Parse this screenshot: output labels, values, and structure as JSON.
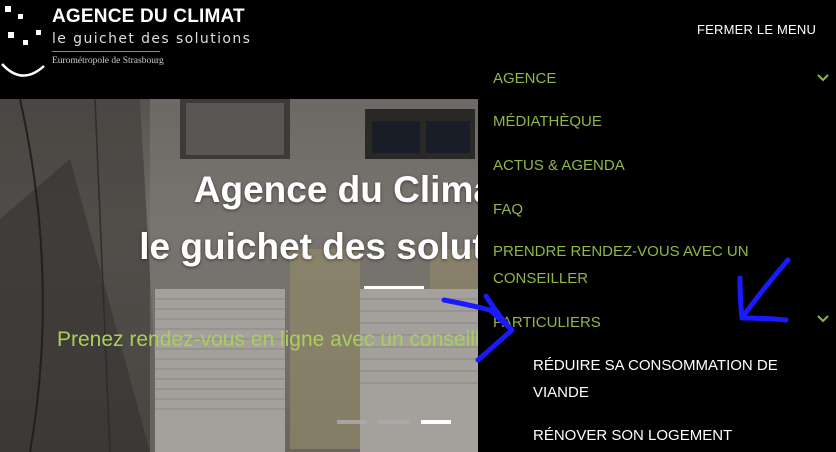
{
  "header": {
    "logo_title": "AGENCE DU CLIMAT",
    "logo_subtitle": "le guichet des solutions",
    "logo_tagline": "Eurométropole de Strasbourg",
    "close_menu": "FERMER LE MENU"
  },
  "hero": {
    "title_line1": "Agence du Climat",
    "title_line2": "le guichet des solutions",
    "subtitle": "Prenez rendez-vous en ligne avec un conseiller",
    "slides": 3,
    "active_slide": 3
  },
  "menu": {
    "items": [
      {
        "label": "AGENCE",
        "has_submenu": true
      },
      {
        "label": "MÉDIATHÈQUE"
      },
      {
        "label": "ACTUS & AGENDA"
      },
      {
        "label": "FAQ"
      },
      {
        "label": "PRENDRE RENDEZ-VOUS AVEC UN CONSEILLER"
      },
      {
        "label": "PARTICULIERS",
        "has_submenu": true
      }
    ],
    "submenu": [
      {
        "label": "RÉDUIRE SA CONSOMMATION DE VIANDE"
      },
      {
        "label": "RÉNOVER SON LOGEMENT"
      }
    ]
  },
  "colors": {
    "menu_text": "#8fb844",
    "hero_subtitle": "#a9cf5a",
    "annotation": "#1a1aff",
    "background": "#000000"
  },
  "icons": [
    "chevron-down-icon"
  ]
}
